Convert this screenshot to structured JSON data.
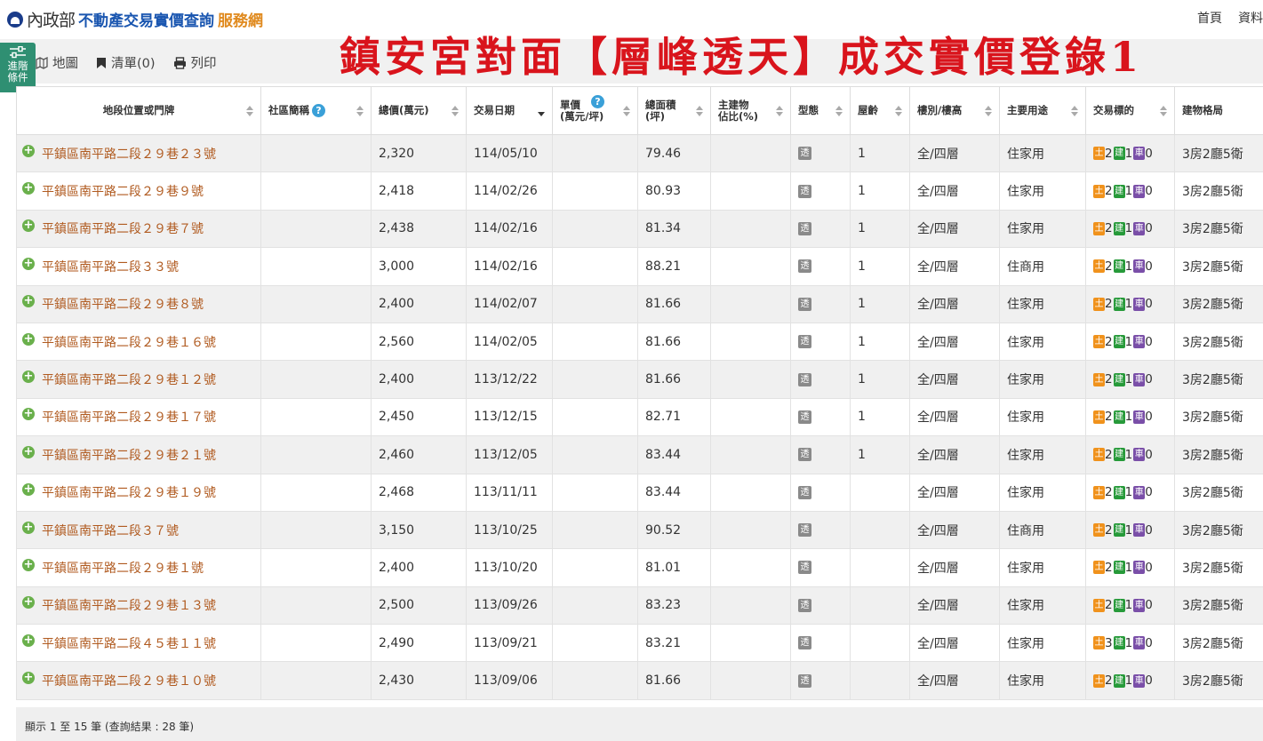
{
  "header": {
    "logo_ministry": "內政部",
    "logo_site": "不動產交易實價查詢",
    "logo_suffix": "服務網",
    "nav": [
      "首頁",
      "資料"
    ]
  },
  "banner": "鎮安宮對面【層峰透天】成交實價登錄1",
  "toolbar": {
    "advanced_label": "進階\n條件",
    "items": [
      {
        "label": "地圖",
        "icon": "map-icon"
      },
      {
        "label": "清單(0)",
        "icon": "bookmark-icon"
      },
      {
        "label": "列印",
        "icon": "print-icon"
      }
    ]
  },
  "table": {
    "columns": [
      {
        "label": "地段位置或門牌"
      },
      {
        "label": "社區簡稱"
      },
      {
        "label": "總價(萬元)"
      },
      {
        "label": "交易日期"
      },
      {
        "label": "單價\n(萬元/坪)"
      },
      {
        "label": "總面積\n(坪)"
      },
      {
        "label": "主建物\n佔比(%)"
      },
      {
        "label": "型態"
      },
      {
        "label": "屋齡"
      },
      {
        "label": "樓別/樓高"
      },
      {
        "label": "主要用途"
      },
      {
        "label": "交易標的"
      },
      {
        "label": "建物格局"
      }
    ],
    "type_badge": "透",
    "tag_labels": {
      "land": "土",
      "build": "建",
      "park": "車"
    },
    "rows": [
      {
        "address": "平鎮區南平路二段２９巷２３號",
        "community": "",
        "price": "2,320",
        "date": "114/05/10",
        "unit_price": "",
        "area": "79.46",
        "main_ratio": "",
        "age": "1",
        "floor": "全/四層",
        "usage": "住家用",
        "land": "2",
        "build": "1",
        "park": "0",
        "layout": "3房2廳5衛"
      },
      {
        "address": "平鎮區南平路二段２９巷９號",
        "community": "",
        "price": "2,418",
        "date": "114/02/26",
        "unit_price": "",
        "area": "80.93",
        "main_ratio": "",
        "age": "1",
        "floor": "全/四層",
        "usage": "住家用",
        "land": "2",
        "build": "1",
        "park": "0",
        "layout": "3房2廳5衛"
      },
      {
        "address": "平鎮區南平路二段２９巷７號",
        "community": "",
        "price": "2,438",
        "date": "114/02/16",
        "unit_price": "",
        "area": "81.34",
        "main_ratio": "",
        "age": "1",
        "floor": "全/四層",
        "usage": "住家用",
        "land": "2",
        "build": "1",
        "park": "0",
        "layout": "3房2廳5衛"
      },
      {
        "address": "平鎮區南平路二段３３號",
        "community": "",
        "price": "3,000",
        "date": "114/02/16",
        "unit_price": "",
        "area": "88.21",
        "main_ratio": "",
        "age": "1",
        "floor": "全/四層",
        "usage": "住商用",
        "land": "2",
        "build": "1",
        "park": "0",
        "layout": "3房2廳5衛"
      },
      {
        "address": "平鎮區南平路二段２９巷８號",
        "community": "",
        "price": "2,400",
        "date": "114/02/07",
        "unit_price": "",
        "area": "81.66",
        "main_ratio": "",
        "age": "1",
        "floor": "全/四層",
        "usage": "住家用",
        "land": "2",
        "build": "1",
        "park": "0",
        "layout": "3房2廳5衛"
      },
      {
        "address": "平鎮區南平路二段２９巷１６號",
        "community": "",
        "price": "2,560",
        "date": "114/02/05",
        "unit_price": "",
        "area": "81.66",
        "main_ratio": "",
        "age": "1",
        "floor": "全/四層",
        "usage": "住家用",
        "land": "2",
        "build": "1",
        "park": "0",
        "layout": "3房2廳5衛"
      },
      {
        "address": "平鎮區南平路二段２９巷１２號",
        "community": "",
        "price": "2,400",
        "date": "113/12/22",
        "unit_price": "",
        "area": "81.66",
        "main_ratio": "",
        "age": "1",
        "floor": "全/四層",
        "usage": "住家用",
        "land": "2",
        "build": "1",
        "park": "0",
        "layout": "3房2廳5衛"
      },
      {
        "address": "平鎮區南平路二段２９巷１７號",
        "community": "",
        "price": "2,450",
        "date": "113/12/15",
        "unit_price": "",
        "area": "82.71",
        "main_ratio": "",
        "age": "1",
        "floor": "全/四層",
        "usage": "住家用",
        "land": "2",
        "build": "1",
        "park": "0",
        "layout": "3房2廳5衛"
      },
      {
        "address": "平鎮區南平路二段２９巷２１號",
        "community": "",
        "price": "2,460",
        "date": "113/12/05",
        "unit_price": "",
        "area": "83.44",
        "main_ratio": "",
        "age": "1",
        "floor": "全/四層",
        "usage": "住家用",
        "land": "2",
        "build": "1",
        "park": "0",
        "layout": "3房2廳5衛"
      },
      {
        "address": "平鎮區南平路二段２９巷１９號",
        "community": "",
        "price": "2,468",
        "date": "113/11/11",
        "unit_price": "",
        "area": "83.44",
        "main_ratio": "",
        "age": "",
        "floor": "全/四層",
        "usage": "住家用",
        "land": "2",
        "build": "1",
        "park": "0",
        "layout": "3房2廳5衛"
      },
      {
        "address": "平鎮區南平路二段３７號",
        "community": "",
        "price": "3,150",
        "date": "113/10/25",
        "unit_price": "",
        "area": "90.52",
        "main_ratio": "",
        "age": "",
        "floor": "全/四層",
        "usage": "住商用",
        "land": "2",
        "build": "1",
        "park": "0",
        "layout": "3房2廳5衛"
      },
      {
        "address": "平鎮區南平路二段２９巷１號",
        "community": "",
        "price": "2,400",
        "date": "113/10/20",
        "unit_price": "",
        "area": "81.01",
        "main_ratio": "",
        "age": "",
        "floor": "全/四層",
        "usage": "住家用",
        "land": "2",
        "build": "1",
        "park": "0",
        "layout": "3房2廳5衛"
      },
      {
        "address": "平鎮區南平路二段２９巷１３號",
        "community": "",
        "price": "2,500",
        "date": "113/09/26",
        "unit_price": "",
        "area": "83.23",
        "main_ratio": "",
        "age": "",
        "floor": "全/四層",
        "usage": "住家用",
        "land": "2",
        "build": "1",
        "park": "0",
        "layout": "3房2廳5衛"
      },
      {
        "address": "平鎮區南平路二段４５巷１１號",
        "community": "",
        "price": "2,490",
        "date": "113/09/21",
        "unit_price": "",
        "area": "83.21",
        "main_ratio": "",
        "age": "",
        "floor": "全/四層",
        "usage": "住家用",
        "land": "3",
        "build": "1",
        "park": "0",
        "layout": "3房2廳5衛"
      },
      {
        "address": "平鎮區南平路二段２９巷１０號",
        "community": "",
        "price": "2,430",
        "date": "113/09/06",
        "unit_price": "",
        "area": "81.66",
        "main_ratio": "",
        "age": "",
        "floor": "全/四層",
        "usage": "住家用",
        "land": "2",
        "build": "1",
        "park": "0",
        "layout": "3房2廳5衛"
      }
    ]
  },
  "footer": {
    "summary": "顯示 1 至 15 筆 (查詢結果 : 28 筆)"
  }
}
